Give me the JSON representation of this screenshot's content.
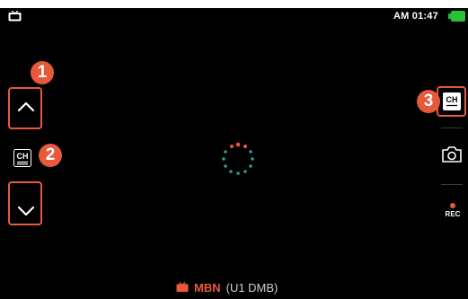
{
  "status_bar": {
    "time": "AM 01:47",
    "battery_color": "#27c13a",
    "tv_icon": "tv-icon"
  },
  "left_controls": {
    "up_icon": "chevron-up-icon",
    "channel_label": "CH",
    "down_icon": "chevron-down-icon",
    "callout_1": "1",
    "callout_2": "2"
  },
  "right_controls": {
    "channel_list_label": "CH",
    "callout_3": "3",
    "capture_icon": "camera-icon",
    "rec_label": "REC",
    "rec_color": "#e8583b"
  },
  "center": {
    "loading_icon": "loading-spinner-icon"
  },
  "bottom": {
    "channel_name": "MBN",
    "channel_detail": "(U1 DMB)"
  },
  "accent_color": "#e8583b"
}
